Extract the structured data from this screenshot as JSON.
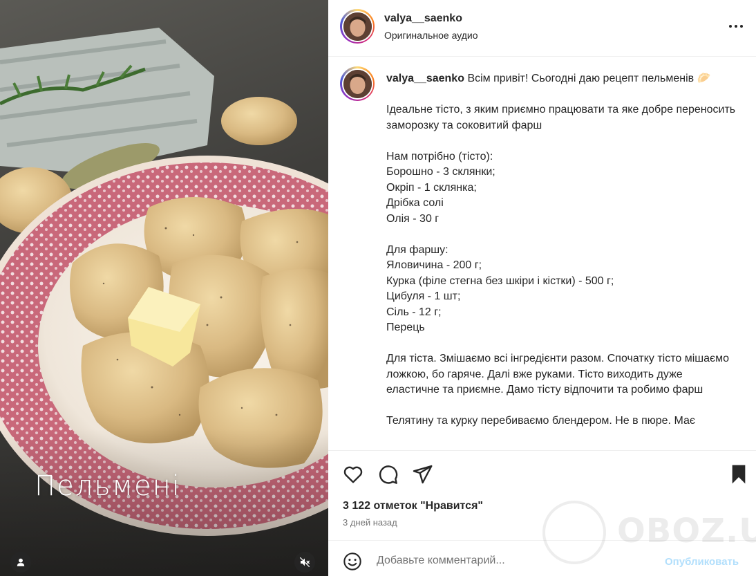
{
  "media": {
    "overlay_title": "Пельмені",
    "user_tag_icon": "user-icon",
    "mute_icon": "speaker-muted-icon"
  },
  "header": {
    "username": "valya__saenko",
    "audio": "Оригинальное аудио",
    "more_icon": "more-horizontal-icon"
  },
  "caption": {
    "username": "valya__saenko",
    "lines": [
      "Всім привіт! Сьогодні даю рецепт пельменів 🥟",
      "",
      "Ідеальне тісто, з яким приємно працювати та яке добре переносить заморозку та соковитий фарш",
      "",
      "Нам потрібно (тісто):",
      "Борошно - 3 склянки;",
      "Окріп - 1 склянка;",
      "Дрібка солі",
      "Олія - 30 г",
      "",
      "Для фаршу:",
      "Яловичина - 200 г;",
      "Курка (філе стегна без шкіри і кістки) - 500 г;",
      "Цибуля - 1 шт;",
      "Сіль - 12 г;",
      "Перець",
      "",
      "Для тіста. Змішаємо всі інгредієнти разом. Спочатку тісто мішаємо ложкою, бо гаряче. Далі вже руками. Тісто виходить дуже еластичне та приємне. Дамо тісту відпочити та робимо фарш",
      "",
      "Телятину та курку перебиваємо блендером. Не в пюре. Має"
    ]
  },
  "actions": {
    "like_icon": "heart-icon",
    "comment_icon": "comment-icon",
    "share_icon": "send-icon",
    "save_icon": "bookmark-icon",
    "likes": "3 122 отметок \"Нравится\"",
    "time_ago": "3 дней назад"
  },
  "comment_bar": {
    "emoji_icon": "emoji-icon",
    "placeholder": "Добавьте комментарий...",
    "publish_label": "Опубликовать"
  },
  "watermark": {
    "text": "OBOZ.UA"
  },
  "colors": {
    "publish_disabled": "#b2dffc",
    "text": "#262626",
    "secondary_text": "#737373",
    "divider": "#efefef"
  }
}
